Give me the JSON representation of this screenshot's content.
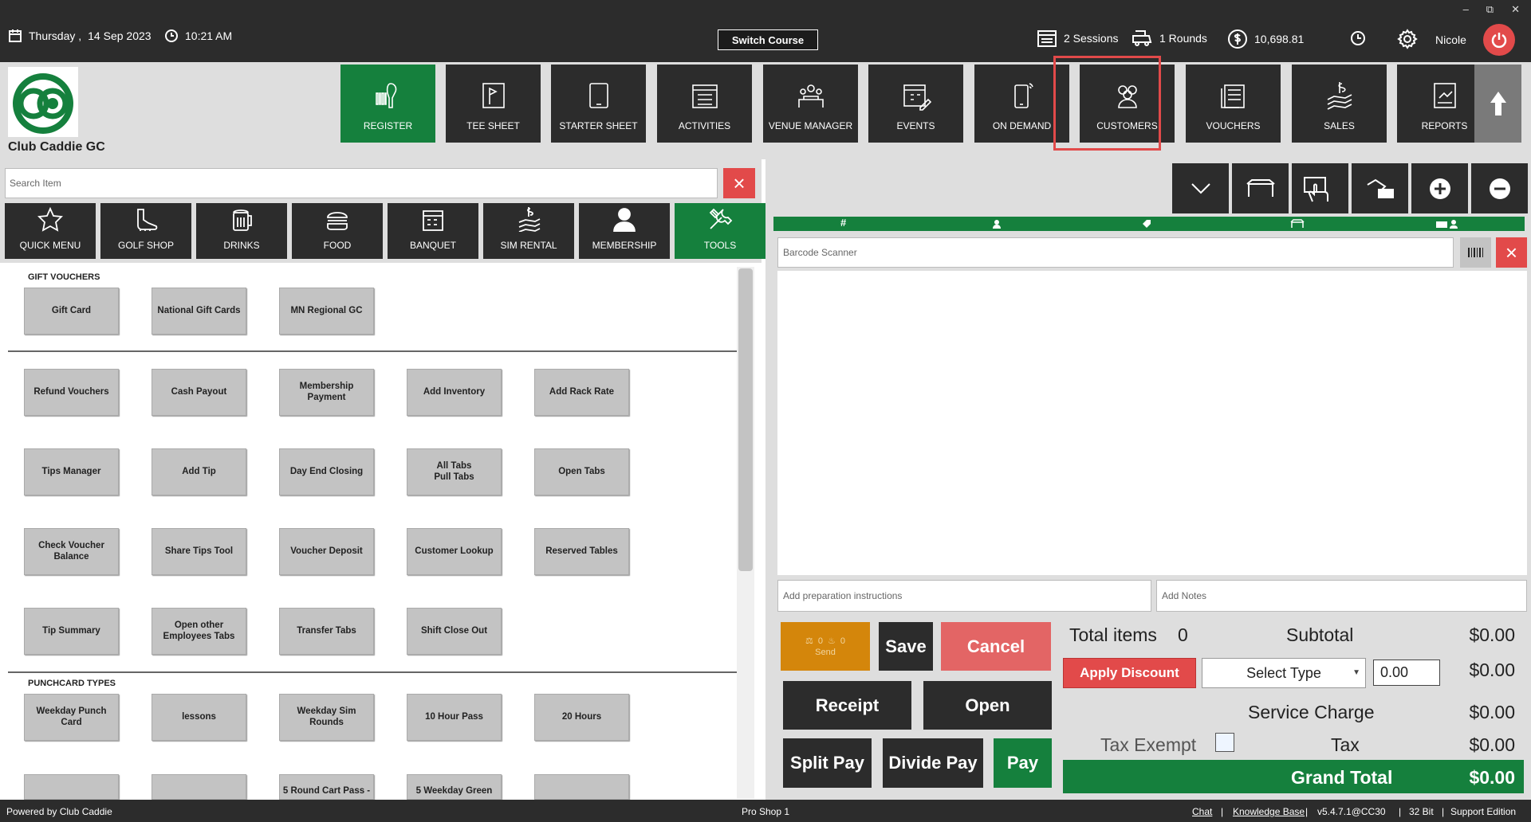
{
  "window": {
    "minimize": "–",
    "restore": "⧉",
    "close": "✕"
  },
  "topbar": {
    "day": "Thursday ,",
    "date": "14 Sep 2023",
    "time": "10:21 AM",
    "switch_course": "Switch Course",
    "sessions": "2 Sessions",
    "rounds": "1 Rounds",
    "balance": "10,698.81",
    "user": "Nicole"
  },
  "brand": {
    "club_name": "Club Caddie GC",
    "colors": {
      "green": "#15803d",
      "dark": "#2c2c2c",
      "red": "#e24a4a",
      "orange": "#d4860b"
    }
  },
  "nav": [
    {
      "label": "REGISTER",
      "icon": "barcode-scanner-icon",
      "active": true
    },
    {
      "label": "TEE SHEET",
      "icon": "tee-sheet-icon"
    },
    {
      "label": "STARTER SHEET",
      "icon": "tablet-icon"
    },
    {
      "label": "ACTIVITIES",
      "icon": "activities-list-icon"
    },
    {
      "label": "VENUE MANAGER",
      "icon": "venue-icon"
    },
    {
      "label": "EVENTS",
      "icon": "calendar-edit-icon"
    },
    {
      "label": "ON DEMAND",
      "icon": "phone-icon"
    },
    {
      "label": "CUSTOMERS",
      "icon": "customers-icon",
      "highlighted": true
    },
    {
      "label": "VOUCHERS",
      "icon": "voucher-icon"
    },
    {
      "label": "SALES",
      "icon": "sales-icon"
    },
    {
      "label": "REPORTS",
      "icon": "report-icon"
    }
  ],
  "search": {
    "placeholder": "Search Item"
  },
  "categories": [
    {
      "label": "QUICK MENU",
      "icon": "star-icon"
    },
    {
      "label": "GOLF SHOP",
      "icon": "golf-shoe-icon"
    },
    {
      "label": "DRINKS",
      "icon": "beer-icon"
    },
    {
      "label": "FOOD",
      "icon": "burger-icon"
    },
    {
      "label": "BANQUET",
      "icon": "banquet-calendar-icon"
    },
    {
      "label": "SIM RENTAL",
      "icon": "sim-money-icon"
    },
    {
      "label": "MEMBERSHIP",
      "icon": "person-icon"
    },
    {
      "label": "TOOLS",
      "icon": "tools-icon",
      "active": true
    }
  ],
  "sections": {
    "gift_vouchers": "GIFT VOUCHERS",
    "punchcard_types": "PUNCHCARD TYPES"
  },
  "gift_vouchers": [
    "Gift Card",
    "National Gift Cards",
    "MN Regional GC"
  ],
  "tools": [
    [
      "Refund Vouchers",
      "Cash Payout",
      "Membership Payment",
      "Add Inventory",
      "Add Rack Rate"
    ],
    [
      "Tips Manager",
      "Add Tip",
      "Day End Closing",
      "All Tabs\nPull Tabs",
      "Open Tabs"
    ],
    [
      "Check Voucher\nBalance",
      "Share Tips Tool",
      "Voucher Deposit",
      "Customer Lookup",
      "Reserved Tables"
    ],
    [
      "Tip Summary",
      "Open other\nEmployees Tabs",
      "Transfer Tabs",
      "Shift Close Out"
    ]
  ],
  "punchcards": [
    "Weekday Punch Card",
    "lessons",
    "Weekday Sim Rounds",
    "10 Hour Pass",
    "20 Hours"
  ],
  "punchcards_partial": [
    "",
    "",
    "5 Round Cart Pass -",
    "5 Weekday Green",
    ""
  ],
  "order": {
    "barcode_placeholder": "Barcode Scanner",
    "prep_placeholder": "Add preparation instructions",
    "notes_placeholder": "Add Notes",
    "columns": [
      "#",
      "person",
      "tag",
      "seat",
      "card-person"
    ]
  },
  "actions": {
    "send": "Send",
    "send_count1": "0",
    "send_count2": "0",
    "save": "Save",
    "cancel": "Cancel",
    "receipt": "Receipt",
    "open": "Open",
    "split_pay": "Split Pay",
    "divide_pay": "Divide Pay",
    "pay": "Pay"
  },
  "totals": {
    "total_items_label": "Total items",
    "total_items": "0",
    "subtotal_label": "Subtotal",
    "subtotal": "$0.00",
    "apply_discount": "Apply Discount",
    "select_type": "Select Type",
    "discount_value": "0.00",
    "discount": "$0.00",
    "service_charge_label": "Service Charge",
    "service_charge": "$0.00",
    "tax_exempt_label": "Tax Exempt",
    "tax_label": "Tax",
    "tax": "$0.00",
    "grand_total_label": "Grand Total",
    "grand_total": "$0.00"
  },
  "footer": {
    "powered": "Powered by Club Caddie",
    "station": "Pro Shop 1",
    "chat": "Chat",
    "kb": "Knowledge Base",
    "version": "v5.4.7.1@CC30",
    "bits": "32 Bit",
    "edition": "Support Edition",
    "sep": "|"
  }
}
